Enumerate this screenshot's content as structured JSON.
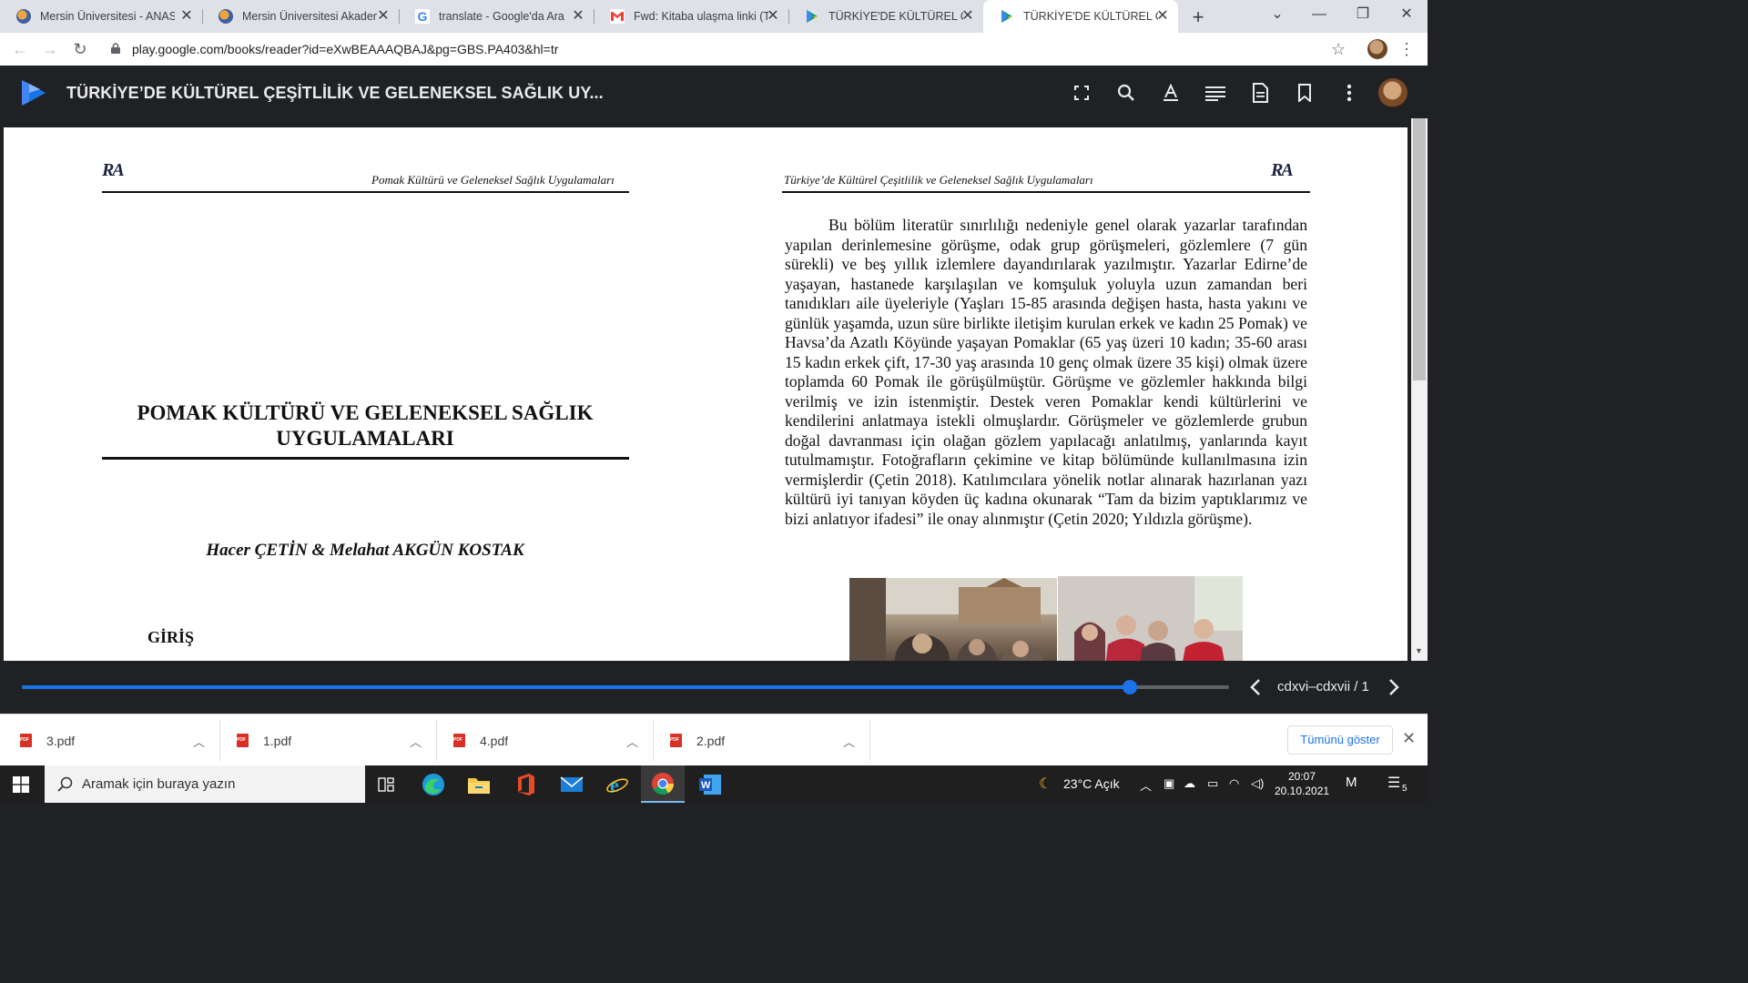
{
  "browser": {
    "tabs": [
      {
        "title": "Mersin Üniversitesi - ANASAYFA",
        "favicon": "mersin-university-icon",
        "active": false
      },
      {
        "title": "Mersin Üniversitesi Akademik",
        "favicon": "mersin-university-icon",
        "active": false
      },
      {
        "title": "translate - Google'da Ara",
        "favicon": "google-icon",
        "active": false
      },
      {
        "title": "Fwd: Kitaba ulaşma linki (TÜ",
        "favicon": "gmail-icon",
        "active": false
      },
      {
        "title": "TÜRKİYE'DE KÜLTÜREL ÇEŞİTLİLİK",
        "favicon": "play-books-icon",
        "active": false
      },
      {
        "title": "TÜRKİYE'DE KÜLTÜREL ÇEŞİTLİLİK",
        "favicon": "play-books-icon",
        "active": true
      }
    ],
    "url": "play.google.com/books/reader?id=eXwBEAAAQBAJ&pg=GBS.PA403&hl=tr"
  },
  "reader": {
    "book_title": "TÜRKİYE’DE KÜLTÜREL ÇEŞİTLİLİK VE GELENEKSEL SAĞLIK UY...",
    "header_icons": [
      "fullscreen-icon",
      "search-icon",
      "text-format-icon",
      "contents-icon",
      "page-view-icon",
      "bookmark-icon",
      "more-vert-icon"
    ],
    "left_page": {
      "logo": "RA",
      "running_head": "Pomak Kültürü ve Geleneksel Sağlık Uygulamaları",
      "chapter_title": "POMAK KÜLTÜRÜ VE GELENEKSEL SAĞLIK UYGULAMALARI",
      "authors": "Hacer ÇETİN & Melahat AKGÜN KOSTAK",
      "section_heading": "GİRİŞ"
    },
    "right_page": {
      "logo": "RA",
      "running_head": "Türkiye’de Kültürel Çeşitlilik ve Geleneksel Sağlık Uygulamaları",
      "paragraph": "Bu bölüm literatür sınırlılığı nedeniyle genel olarak yazarlar tarafından yapılan derinlemesine görüşme, odak grup görüşmeleri, gözlemlere (7 gün sürekli) ve beş yıllık izlemlere dayandırılarak yazılmıştır. Yazarlar Edirne’de yaşayan, hastanede karşılaşılan ve komşuluk yoluyla uzun zamandan beri tanıdıkları aile üyeleriyle (Yaşları 15-85 arasında değişen hasta, hasta yakını ve günlük yaşamda, uzun süre birlikte iletişim kurulan erkek ve kadın 25 Pomak) ve Havsa’da Azatlı Köyünde yaşayan Pomaklar (65 yaş üzeri 10 kadın; 35-60 arası 15 kadın erkek çift, 17-30 yaş arasında 10 genç olmak üzere 35 kişi) olmak üzere toplamda 60 Pomak ile görüşülmüştür. Görüşme ve gözlemler hakkında bilgi verilmiş ve izin istenmiştir. Destek veren Pomaklar kendi kültürlerini ve kendilerini anlatmaya istekli olmuşlardır. Görüşmeler ve gözlemlerde grubun doğal davranması için olağan gözlem yapılacağı anlatılmış, yanlarında kayıt tutulmamıştır. Fotoğrafların çekimine ve kitap bölümünde kullanılmasına izin vermişlerdir (Çetin 2018).  Katılımcılara yönelik notlar alınarak hazırlanan yazı kültürü iyi tanıyan köyden üç kadına okunarak “Tam da bizim yaptıklarımız ve bizi anlatıyor ifadesi” ile onay alınmıştır (Çetin 2020; Yıldızla görüşme)."
    },
    "page_indicator": "cdxvi–cdxvii / 1",
    "progress": 0.918
  },
  "downloads": {
    "files": [
      "3.pdf",
      "1.pdf",
      "4.pdf",
      "2.pdf"
    ],
    "show_all_label": "Tümünü göster"
  },
  "taskbar": {
    "search_placeholder": "Aramak için buraya yazın",
    "weather": "23°C  Açık",
    "time": "20:07",
    "date": "20.10.2021",
    "notification_count": "5"
  },
  "colors": {
    "accent": "#1a73e8",
    "reader_bg": "#202124",
    "pdf_red": "#d93025"
  }
}
